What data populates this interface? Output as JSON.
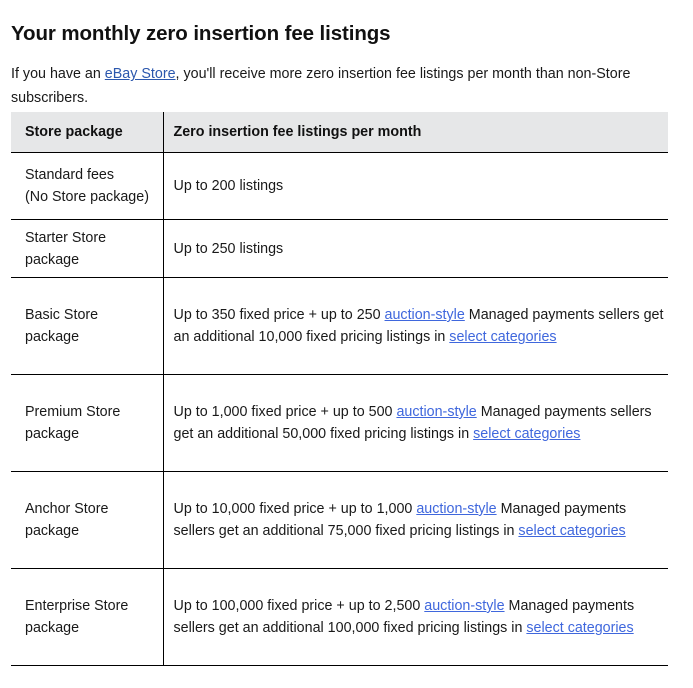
{
  "page": {
    "title": "Your monthly zero insertion fee listings",
    "intro": {
      "before_link": "If you have an ",
      "link_text": "eBay Store",
      "after_link": ", you'll receive more zero insertion fee listings per month than non-Store subscribers."
    }
  },
  "colors": {
    "header_background": "#e6e7e8",
    "border": "#000000",
    "text": "#191919",
    "heading_text": "#111111",
    "link_intro": "#2b57ad",
    "link_table": "#3f67dd"
  },
  "table": {
    "columns": [
      "Store package",
      "Zero insertion fee listings per month"
    ],
    "rows": [
      {
        "package": "Standard fees\n(No Store package)",
        "package_lines": [
          "Standard fees",
          "(No Store package)"
        ],
        "primary": "Up to 200 listings",
        "primary_link": null,
        "primary_suffix": null,
        "secondary": null,
        "secondary_link": null
      },
      {
        "package": "Starter Store package",
        "package_lines": [
          "Starter Store",
          "package"
        ],
        "primary": "Up to 250 listings",
        "primary_link": null,
        "primary_suffix": null,
        "secondary": null,
        "secondary_link": null
      },
      {
        "package": "Basic Store package",
        "package_lines": [
          "Basic Store",
          "package"
        ],
        "primary": "Up to 350 fixed price + up to 250 ",
        "primary_link": "auction-style",
        "primary_suffix": "",
        "secondary": "Managed payments sellers get an additional 10,000 fixed pricing listings in ",
        "secondary_link": "select categories"
      },
      {
        "package": "Premium Store package",
        "package_lines": [
          "Premium Store",
          "package"
        ],
        "primary": "Up to 1,000 fixed price + up to 500 ",
        "primary_link": "auction-style",
        "primary_suffix": "",
        "secondary": "Managed payments sellers get an additional 50,000 fixed pricing listings in ",
        "secondary_link": "select categories"
      },
      {
        "package": "Anchor Store package",
        "package_lines": [
          "Anchor Store",
          "package"
        ],
        "primary": "Up to 10,000 fixed price + up to 1,000 ",
        "primary_link": "auction-style",
        "primary_suffix": "",
        "secondary": "Managed payments sellers get an additional 75,000 fixed pricing listings in ",
        "secondary_link": "select categories"
      },
      {
        "package": "Enterprise Store package",
        "package_lines": [
          "Enterprise Store",
          "package"
        ],
        "primary": "Up to 100,000 fixed price + up to 2,500 ",
        "primary_link": "auction-style",
        "primary_suffix": "",
        "secondary": "Managed payments sellers get an additional 100,000 fixed pricing listings in ",
        "secondary_link": "select categories"
      }
    ]
  }
}
